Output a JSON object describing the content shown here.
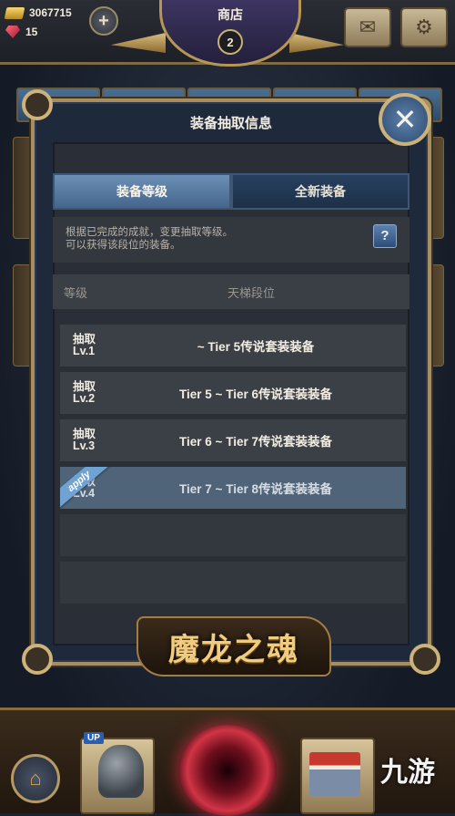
{
  "hud": {
    "gold": "3067715",
    "gems": "15",
    "plus_label": "+",
    "shop_title": "商店",
    "shop_badge": "2"
  },
  "dialog": {
    "title": "装备抽取信息",
    "close_label": "✕",
    "tabs": [
      {
        "label": "装备等级",
        "active": true
      },
      {
        "label": "全新装备",
        "active": false
      }
    ],
    "description": "根据已完成的成就，变更抽取等级。\n可以获得该段位的装备。",
    "help_label": "?",
    "table_headers": {
      "level": "等级",
      "tier": "天梯段位"
    },
    "rows": [
      {
        "level": "抽取\nLv.1",
        "tier": "~ Tier 5传说套装装备",
        "applied": false
      },
      {
        "level": "抽取\nLv.2",
        "tier": "Tier 5 ~ Tier 6传说套装装备",
        "applied": false
      },
      {
        "level": "抽取\nLv.3",
        "tier": "Tier 6 ~ Tier 7传说套装装备",
        "applied": false
      },
      {
        "level": "抽取\nLv.4",
        "tier": "Tier 7 ~ Tier 8传说套装装备",
        "applied": true
      }
    ],
    "apply_badge": "apply"
  },
  "logo_text": "魔龙之魂",
  "bottom": {
    "up_badge": "UP"
  },
  "watermark": "九游",
  "colors": {
    "dialog_border": "#a88e5e",
    "tab_active": "#5a7ea6",
    "applied_row": "#4f6479",
    "apply_ribbon": "#6fa3d4"
  },
  "icons": [
    "gold-bar-icon",
    "gem-icon",
    "plus-icon",
    "mail-icon",
    "settings-gear-icon",
    "close-icon",
    "help-icon",
    "home-icon",
    "helmet-icon",
    "vortex-icon",
    "shop-stall-icon"
  ]
}
